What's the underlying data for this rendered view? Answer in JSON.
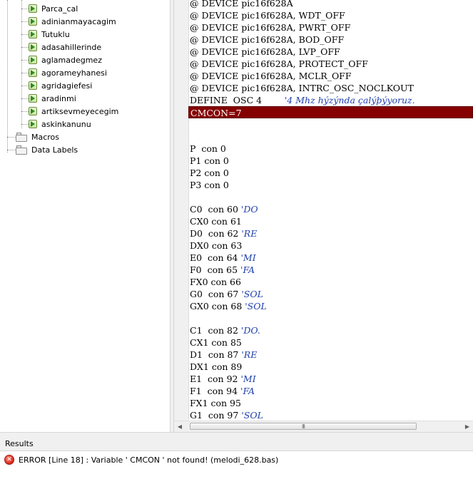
{
  "tree": {
    "subroutines": [
      "Parca_cal",
      "adinianmayacagim",
      "Tutuklu",
      "adasahillerinde",
      "aglamadegmez",
      "agorameyhanesi",
      "agridagiefesi",
      "aradinmi",
      "artiksevmeyecegim",
      "askinkanunu"
    ],
    "folders": [
      "Macros",
      "Data Labels"
    ]
  },
  "editor": {
    "lines": [
      {
        "code": "@ DEVICE pic16f628A",
        "comment": ""
      },
      {
        "code": "@ DEVICE pic16f628A, WDT_OFF",
        "comment": ""
      },
      {
        "code": "@ DEVICE pic16f628A, PWRT_OFF",
        "comment": ""
      },
      {
        "code": "@ DEVICE pic16f628A, BOD_OFF",
        "comment": ""
      },
      {
        "code": "@ DEVICE pic16f628A, LVP_OFF",
        "comment": ""
      },
      {
        "code": "@ DEVICE pic16f628A, PROTECT_OFF",
        "comment": ""
      },
      {
        "code": "@ DEVICE pic16f628A, MCLR_OFF",
        "comment": ""
      },
      {
        "code": "@ DEVICE pic16f628A, INTRC_OSC_NOCLKOUT",
        "comment": ""
      },
      {
        "code": "DEFINE  OSC 4        ",
        "comment": "'4 Mhz hýzýnda çalýþýyoruz."
      },
      {
        "code": "CMCON=7",
        "comment": "",
        "error": true
      },
      {
        "code": "",
        "comment": ""
      },
      {
        "code": "",
        "comment": ""
      },
      {
        "code": "P  con 0",
        "comment": ""
      },
      {
        "code": "P1 con 0",
        "comment": ""
      },
      {
        "code": "P2 con 0",
        "comment": ""
      },
      {
        "code": "P3 con 0",
        "comment": ""
      },
      {
        "code": "",
        "comment": ""
      },
      {
        "code": "C0  con 60 ",
        "comment": "'DO"
      },
      {
        "code": "CX0 con 61",
        "comment": ""
      },
      {
        "code": "D0  con 62 ",
        "comment": "'RE"
      },
      {
        "code": "DX0 con 63",
        "comment": ""
      },
      {
        "code": "E0  con 64 ",
        "comment": "'MI"
      },
      {
        "code": "F0  con 65 ",
        "comment": "'FA"
      },
      {
        "code": "FX0 con 66",
        "comment": ""
      },
      {
        "code": "G0  con 67 ",
        "comment": "'SOL"
      },
      {
        "code": "GX0 con 68 ",
        "comment": "'SOL"
      },
      {
        "code": "",
        "comment": ""
      },
      {
        "code": "C1  con 82 ",
        "comment": "'DO."
      },
      {
        "code": "CX1 con 85",
        "comment": ""
      },
      {
        "code": "D1  con 87 ",
        "comment": "'RE"
      },
      {
        "code": "DX1 con 89",
        "comment": ""
      },
      {
        "code": "E1  con 92 ",
        "comment": "'MI"
      },
      {
        "code": "F1  con 94 ",
        "comment": "'FA"
      },
      {
        "code": "FX1 con 95",
        "comment": ""
      },
      {
        "code": "G1  con 97 ",
        "comment": "'SOL"
      }
    ]
  },
  "scrollbar": {
    "thumb_grip": "III"
  },
  "results": {
    "title": "Results",
    "error_message": "ERROR [Line 18] : Variable ' CMCON ' not found! (melodi_628.bas)"
  },
  "colors": {
    "error_line_bg": "#850000",
    "comment": "#1f3faa",
    "sub_icon": "#4caf50"
  },
  "icons": {
    "subroutine": "green-play-icon",
    "folder": "folder-icon",
    "error": "error-icon"
  }
}
